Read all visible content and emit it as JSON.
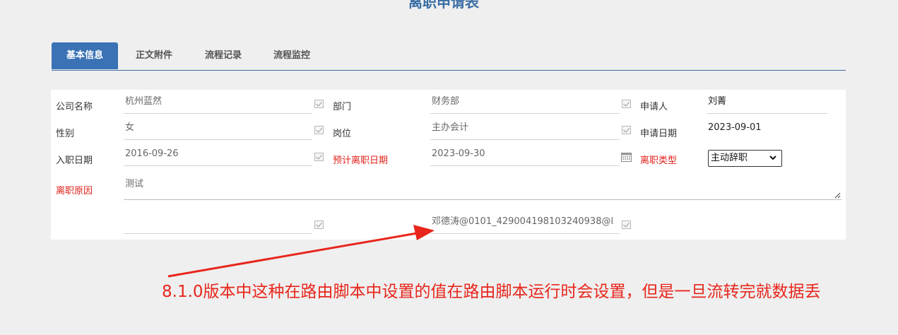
{
  "page_title": "离职申请表",
  "tabs": [
    {
      "label": "基本信息",
      "active": true
    },
    {
      "label": "正文附件",
      "active": false
    },
    {
      "label": "流程记录",
      "active": false
    },
    {
      "label": "流程监控",
      "active": false
    }
  ],
  "form": {
    "company_label": "公司名称",
    "company_value": "杭州蓝然",
    "dept_label": "部门",
    "dept_value": "财务部",
    "applicant_label": "申请人",
    "applicant_value": "刘菁",
    "gender_label": "性别",
    "gender_value": "女",
    "position_label": "岗位",
    "position_value": "主办会计",
    "apply_date_label": "申请日期",
    "apply_date_value": "2023-09-01",
    "hire_date_label": "入职日期",
    "hire_date_value": "2016-09-26",
    "expected_leave_label": "预计离职日期",
    "expected_leave_value": "2023-09-30",
    "leave_type_label": "离职类型",
    "leave_type_value": "主动辞职",
    "reason_label": "离职原因",
    "reason_value": "测试",
    "extra_field_1_value": "",
    "extra_field_2_value": "邓德涛@0101_429004198103240938@l"
  },
  "annotation": "8.1.0版本中这种在路由脚本中设置的值在路由脚本运行时会设置，但是一旦流转完就数据丢",
  "colors": {
    "accent": "#3a72b5",
    "required": "#e0231c",
    "annotation": "#e8261c"
  }
}
